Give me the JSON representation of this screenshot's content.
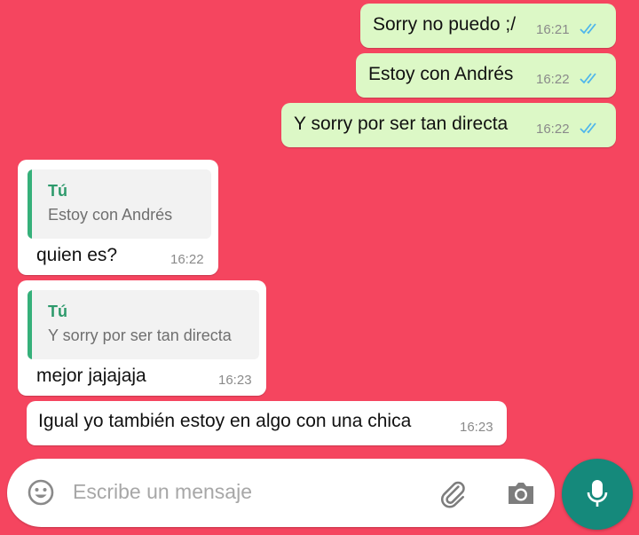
{
  "colors": {
    "background": "#f5455f",
    "outgoing_bubble": "#dcf8c6",
    "incoming_bubble": "#ffffff",
    "quote_accent": "#35b07a",
    "read_ticks": "#4fb6ec",
    "mic_button": "#15897b"
  },
  "messages": [
    {
      "direction": "outgoing",
      "text": "Sorry no puedo ;/",
      "time": "16:21",
      "status": "read"
    },
    {
      "direction": "outgoing",
      "text": "Estoy con Andrés",
      "time": "16:22",
      "status": "read"
    },
    {
      "direction": "outgoing",
      "text": "Y sorry por ser tan directa",
      "time": "16:22",
      "status": "read"
    },
    {
      "direction": "incoming",
      "quote": {
        "author": "Tú",
        "text": "Estoy con Andrés"
      },
      "text": "quien es?",
      "time": "16:22"
    },
    {
      "direction": "incoming",
      "quote": {
        "author": "Tú",
        "text": "Y sorry por ser tan directa"
      },
      "text": "mejor jajajaja",
      "time": "16:23"
    },
    {
      "direction": "incoming",
      "text": "Igual yo también estoy en algo con una chica",
      "time": "16:23"
    }
  ],
  "composer": {
    "placeholder": "Escribe un mensaje",
    "emoji_icon": "emoji-icon",
    "attach_icon": "paperclip-icon",
    "camera_icon": "camera-icon",
    "mic_icon": "microphone-icon"
  }
}
